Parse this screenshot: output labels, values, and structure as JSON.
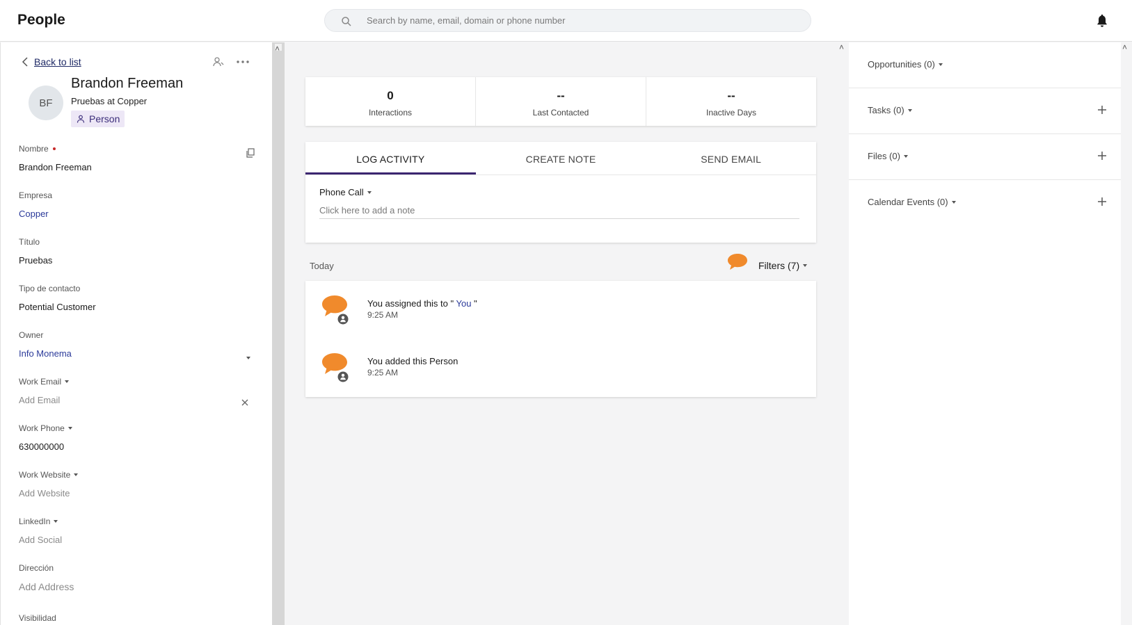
{
  "header": {
    "title": "People",
    "search_placeholder": "Search by name, email, domain or phone number"
  },
  "left": {
    "back_label": "Back to list",
    "avatar_initials": "BF",
    "name": "Brandon Freeman",
    "subtitle": "Pruebas at Copper",
    "badge": "Person",
    "fields": {
      "nombre": {
        "label": "Nombre",
        "value": "Brandon Freeman"
      },
      "empresa": {
        "label": "Empresa",
        "value": "Copper"
      },
      "titulo": {
        "label": "Título",
        "value": "Pruebas"
      },
      "tipo": {
        "label": "Tipo de contacto",
        "value": "Potential Customer"
      },
      "owner": {
        "label": "Owner",
        "value": "Info Monema"
      },
      "work_email": {
        "label": "Work Email",
        "value": "Add Email"
      },
      "work_phone": {
        "label": "Work Phone",
        "value": "630000000"
      },
      "work_website": {
        "label": "Work Website",
        "value": "Add Website"
      },
      "linkedin": {
        "label": "LinkedIn",
        "value": "Add Social"
      },
      "direccion": {
        "label": "Dirección",
        "value": "Add Address"
      },
      "visibilidad": {
        "label": "Visibilidad"
      }
    }
  },
  "stats": [
    {
      "value": "0",
      "caption": "Interactions"
    },
    {
      "value": "--",
      "caption": "Last Contacted"
    },
    {
      "value": "--",
      "caption": "Inactive Days"
    }
  ],
  "activity": {
    "tabs": [
      "LOG ACTIVITY",
      "CREATE NOTE",
      "SEND EMAIL"
    ],
    "type": "Phone Call",
    "note_placeholder": "Click here to add a note"
  },
  "feed": {
    "group": "Today",
    "filters_label": "Filters (7)",
    "items": [
      {
        "text_before": "You assigned this to \"",
        "link": " You",
        "text_after": " \"",
        "time": "9:25 AM"
      },
      {
        "text_before": "You added this Person",
        "time": "9:25 AM"
      }
    ]
  },
  "right": {
    "sections": [
      {
        "label": "Opportunities (0)"
      },
      {
        "label": "Tasks (0)"
      },
      {
        "label": "Files (0)"
      },
      {
        "label": "Calendar Events (0)"
      }
    ]
  },
  "colors": {
    "accent": "#3b2570",
    "bubble": "#f08a2c",
    "link": "#2b3a9a"
  }
}
